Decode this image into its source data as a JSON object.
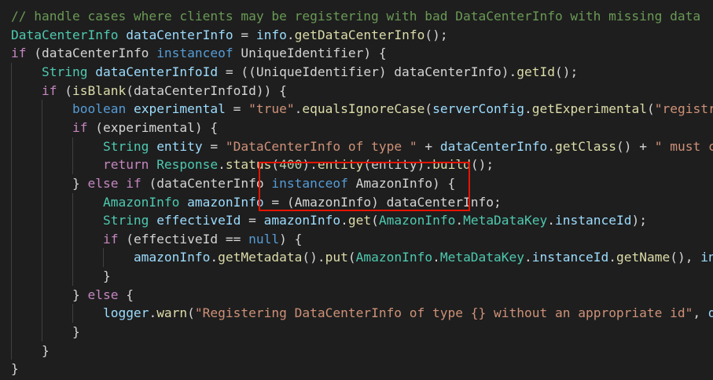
{
  "code": {
    "lines": [
      [
        {
          "t": "// handle cases where clients may be registering with bad DataCenterInfo with missing data",
          "c": "comment"
        }
      ],
      [
        {
          "t": "DataCenterInfo",
          "c": "type"
        },
        {
          "t": " ",
          "c": "punc"
        },
        {
          "t": "dataCenterInfo",
          "c": "var"
        },
        {
          "t": " = ",
          "c": "punc"
        },
        {
          "t": "info",
          "c": "var"
        },
        {
          "t": ".",
          "c": "punc"
        },
        {
          "t": "getDataCenterInfo",
          "c": "fn"
        },
        {
          "t": "();",
          "c": "punc"
        }
      ],
      [
        {
          "t": "if",
          "c": "ctrl"
        },
        {
          "t": " (dataCenterInfo ",
          "c": "punc"
        },
        {
          "t": "instanceof",
          "c": "kw"
        },
        {
          "t": " UniqueIdentifier) {",
          "c": "punc"
        }
      ],
      [
        {
          "t": "    ",
          "c": "punc"
        },
        {
          "t": "String",
          "c": "type"
        },
        {
          "t": " ",
          "c": "punc"
        },
        {
          "t": "dataCenterInfoId",
          "c": "var"
        },
        {
          "t": " = ((UniqueIdentifier) dataCenterInfo).",
          "c": "punc"
        },
        {
          "t": "getId",
          "c": "fn"
        },
        {
          "t": "();",
          "c": "punc"
        }
      ],
      [
        {
          "t": "    ",
          "c": "punc"
        },
        {
          "t": "if",
          "c": "ctrl"
        },
        {
          "t": " (",
          "c": "punc"
        },
        {
          "t": "isBlank",
          "c": "fn"
        },
        {
          "t": "(dataCenterInfoId)) {",
          "c": "punc"
        }
      ],
      [
        {
          "t": "        ",
          "c": "punc"
        },
        {
          "t": "boolean",
          "c": "kw"
        },
        {
          "t": " ",
          "c": "punc"
        },
        {
          "t": "experimental",
          "c": "var"
        },
        {
          "t": " = ",
          "c": "punc"
        },
        {
          "t": "\"true\"",
          "c": "str"
        },
        {
          "t": ".",
          "c": "punc"
        },
        {
          "t": "equalsIgnoreCase",
          "c": "fn"
        },
        {
          "t": "(",
          "c": "punc"
        },
        {
          "t": "serverConfig",
          "c": "var"
        },
        {
          "t": ".",
          "c": "punc"
        },
        {
          "t": "getExperimental",
          "c": "fn"
        },
        {
          "t": "(",
          "c": "punc"
        },
        {
          "t": "\"registra",
          "c": "str"
        }
      ],
      [
        {
          "t": "        ",
          "c": "punc"
        },
        {
          "t": "if",
          "c": "ctrl"
        },
        {
          "t": " (experimental) {",
          "c": "punc"
        }
      ],
      [
        {
          "t": "            ",
          "c": "punc"
        },
        {
          "t": "String",
          "c": "type"
        },
        {
          "t": " ",
          "c": "punc"
        },
        {
          "t": "entity",
          "c": "var"
        },
        {
          "t": " = ",
          "c": "punc"
        },
        {
          "t": "\"DataCenterInfo of type \"",
          "c": "str"
        },
        {
          "t": " + ",
          "c": "punc"
        },
        {
          "t": "dataCenterInfo",
          "c": "var"
        },
        {
          "t": ".",
          "c": "punc"
        },
        {
          "t": "getClass",
          "c": "fn"
        },
        {
          "t": "() + ",
          "c": "punc"
        },
        {
          "t": "\" must co",
          "c": "str"
        }
      ],
      [
        {
          "t": "            ",
          "c": "punc"
        },
        {
          "t": "return",
          "c": "ctrl"
        },
        {
          "t": " ",
          "c": "punc"
        },
        {
          "t": "Response",
          "c": "type"
        },
        {
          "t": ".",
          "c": "punc"
        },
        {
          "t": "status",
          "c": "fn"
        },
        {
          "t": "(",
          "c": "punc"
        },
        {
          "t": "400",
          "c": "num"
        },
        {
          "t": ").",
          "c": "punc"
        },
        {
          "t": "entity",
          "c": "fn"
        },
        {
          "t": "(entity).",
          "c": "punc"
        },
        {
          "t": "build",
          "c": "fn"
        },
        {
          "t": "();",
          "c": "punc"
        }
      ],
      [
        {
          "t": "        } ",
          "c": "punc"
        },
        {
          "t": "else",
          "c": "ctrl"
        },
        {
          "t": " ",
          "c": "punc"
        },
        {
          "t": "if",
          "c": "ctrl"
        },
        {
          "t": " (dataCenterInfo ",
          "c": "punc"
        },
        {
          "t": "instanceof",
          "c": "kw"
        },
        {
          "t": " AmazonInfo) {",
          "c": "punc"
        }
      ],
      [
        {
          "t": "            ",
          "c": "punc"
        },
        {
          "t": "AmazonInfo",
          "c": "type"
        },
        {
          "t": " ",
          "c": "punc"
        },
        {
          "t": "amazonInfo",
          "c": "var"
        },
        {
          "t": " = (AmazonInfo) dataCenterInfo;",
          "c": "punc"
        }
      ],
      [
        {
          "t": "            ",
          "c": "punc"
        },
        {
          "t": "String",
          "c": "type"
        },
        {
          "t": " ",
          "c": "punc"
        },
        {
          "t": "effectiveId",
          "c": "var"
        },
        {
          "t": " = ",
          "c": "punc"
        },
        {
          "t": "amazonInfo",
          "c": "var"
        },
        {
          "t": ".",
          "c": "punc"
        },
        {
          "t": "get",
          "c": "fn"
        },
        {
          "t": "(",
          "c": "punc"
        },
        {
          "t": "AmazonInfo",
          "c": "type"
        },
        {
          "t": ".",
          "c": "punc"
        },
        {
          "t": "MetaDataKey",
          "c": "type"
        },
        {
          "t": ".",
          "c": "punc"
        },
        {
          "t": "instanceId",
          "c": "var"
        },
        {
          "t": ");",
          "c": "punc"
        }
      ],
      [
        {
          "t": "            ",
          "c": "punc"
        },
        {
          "t": "if",
          "c": "ctrl"
        },
        {
          "t": " (effectiveId == ",
          "c": "punc"
        },
        {
          "t": "null",
          "c": "kw"
        },
        {
          "t": ") {",
          "c": "punc"
        }
      ],
      [
        {
          "t": "                ",
          "c": "punc"
        },
        {
          "t": "amazonInfo",
          "c": "var"
        },
        {
          "t": ".",
          "c": "punc"
        },
        {
          "t": "getMetadata",
          "c": "fn"
        },
        {
          "t": "().",
          "c": "punc"
        },
        {
          "t": "put",
          "c": "fn"
        },
        {
          "t": "(",
          "c": "punc"
        },
        {
          "t": "AmazonInfo",
          "c": "type"
        },
        {
          "t": ".",
          "c": "punc"
        },
        {
          "t": "MetaDataKey",
          "c": "type"
        },
        {
          "t": ".",
          "c": "punc"
        },
        {
          "t": "instanceId",
          "c": "var"
        },
        {
          "t": ".",
          "c": "punc"
        },
        {
          "t": "getName",
          "c": "fn"
        },
        {
          "t": "(), ",
          "c": "punc"
        },
        {
          "t": "inf",
          "c": "var"
        }
      ],
      [
        {
          "t": "            }",
          "c": "punc"
        }
      ],
      [
        {
          "t": "        } ",
          "c": "punc"
        },
        {
          "t": "else",
          "c": "ctrl"
        },
        {
          "t": " {",
          "c": "punc"
        }
      ],
      [
        {
          "t": "            ",
          "c": "punc"
        },
        {
          "t": "logger",
          "c": "var"
        },
        {
          "t": ".",
          "c": "punc"
        },
        {
          "t": "warn",
          "c": "fn"
        },
        {
          "t": "(",
          "c": "punc"
        },
        {
          "t": "\"Registering DataCenterInfo of type {} without an appropriate id\"",
          "c": "str"
        },
        {
          "t": ", ",
          "c": "punc"
        },
        {
          "t": "da",
          "c": "var"
        }
      ],
      [
        {
          "t": "        }",
          "c": "punc"
        }
      ],
      [
        {
          "t": "    }",
          "c": "punc"
        }
      ],
      [
        {
          "t": "}",
          "c": "punc"
        }
      ]
    ]
  },
  "colors": {
    "background": "#1e1e1e",
    "comment": "#6a9955",
    "keyword": "#569cd6",
    "control": "#c586c0",
    "type": "#4ec9b0",
    "variable": "#9cdcfe",
    "function": "#dcdcaa",
    "string": "#ce9178",
    "number": "#b5cea8",
    "highlight_box": "#e51400"
  }
}
